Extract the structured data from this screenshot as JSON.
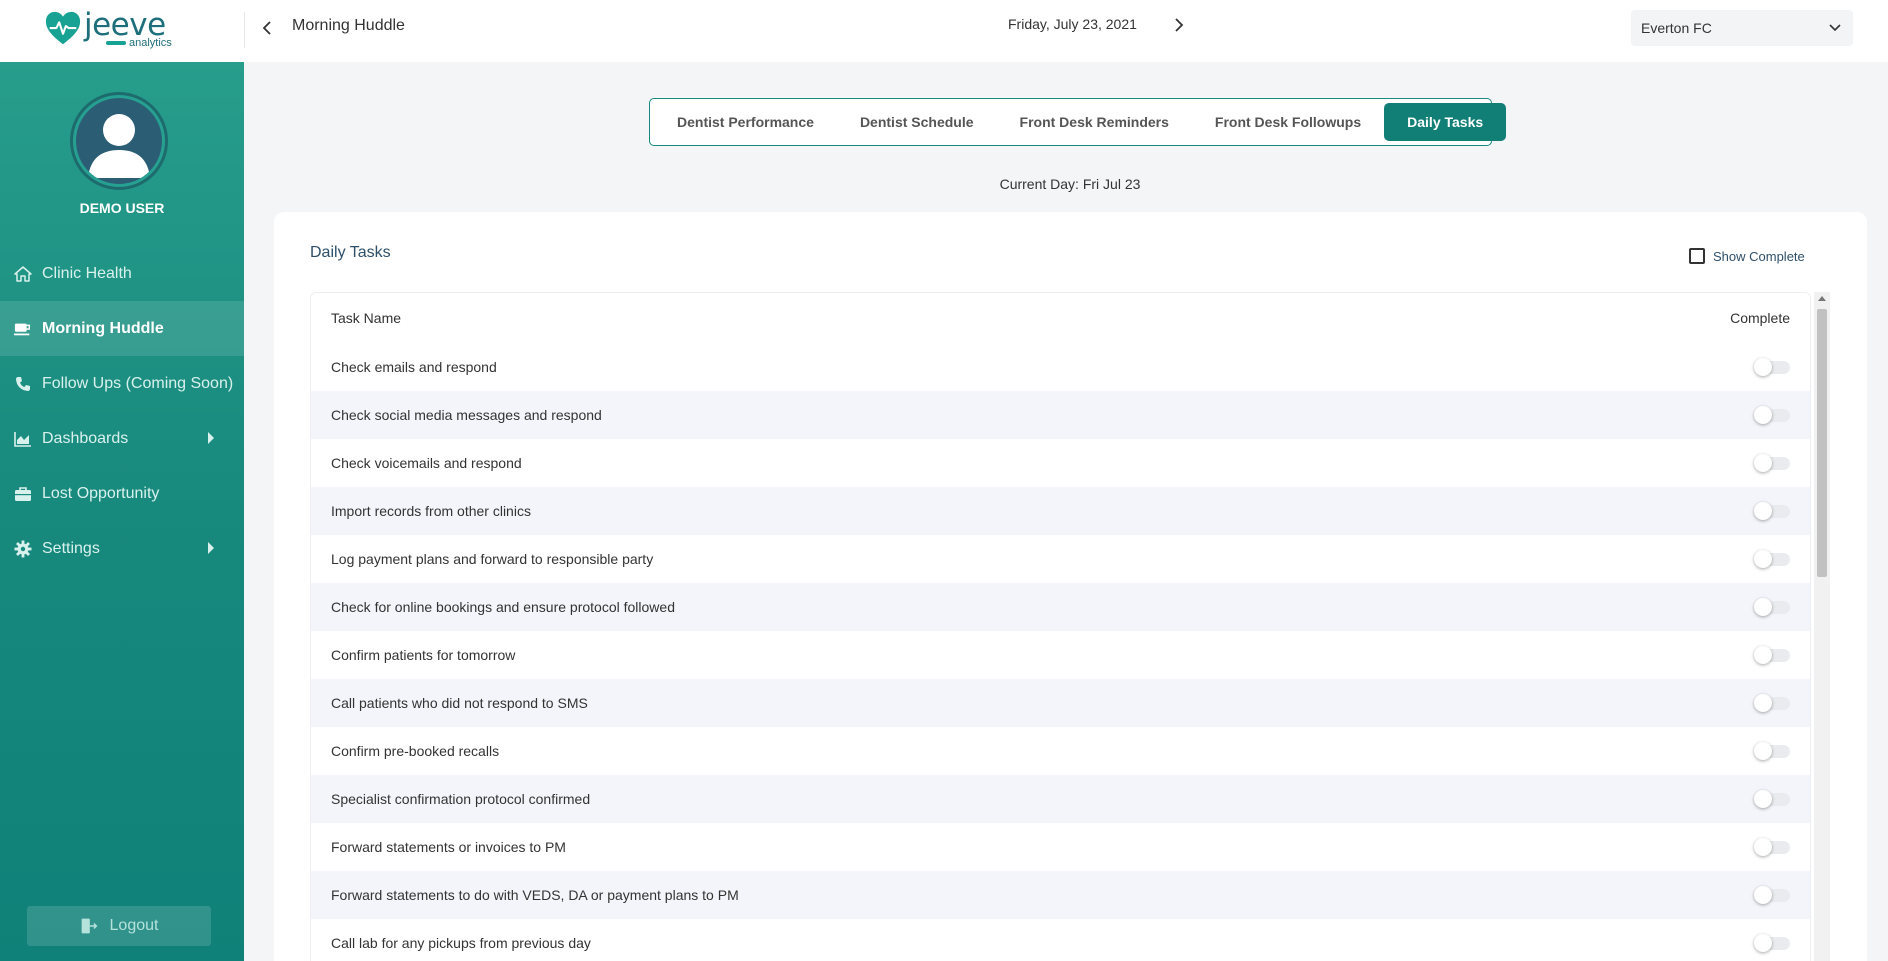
{
  "header": {
    "brand_word": "jeeve",
    "brand_sub": "analytics",
    "title": "Morning Huddle",
    "date": "Friday, July 23, 2021",
    "clinic": "Everton FC"
  },
  "sidebar": {
    "user_name": "DEMO USER",
    "items": [
      {
        "label": "Clinic Health",
        "icon": "home-icon"
      },
      {
        "label": "Morning Huddle",
        "icon": "coffee-cup-icon",
        "active": true
      },
      {
        "label": "Follow Ups (Coming Soon)",
        "icon": "phone-icon"
      },
      {
        "label": "Dashboards",
        "icon": "chart-icon",
        "has_submenu": true
      },
      {
        "label": "Lost Opportunity",
        "icon": "briefcase-icon"
      },
      {
        "label": "Settings",
        "icon": "gear-icon",
        "has_submenu": true
      }
    ],
    "logout_label": "Logout"
  },
  "tabs": [
    {
      "label": "Dentist Performance"
    },
    {
      "label": "Dentist Schedule"
    },
    {
      "label": "Front Desk Reminders"
    },
    {
      "label": "Front Desk Followups"
    },
    {
      "label": "Daily Tasks",
      "active": true
    }
  ],
  "current_day": "Current Day: Fri Jul 23",
  "card": {
    "title": "Daily Tasks",
    "show_complete_label": "Show Complete",
    "show_complete_checked": false
  },
  "table": {
    "columns": [
      "Task Name",
      "Complete"
    ],
    "rows": [
      {
        "task": "Check emails and respond",
        "complete": false
      },
      {
        "task": "Check social media messages and respond",
        "complete": false
      },
      {
        "task": "Check voicemails and respond",
        "complete": false
      },
      {
        "task": "Import records from other clinics",
        "complete": false
      },
      {
        "task": "Log payment plans and forward to responsible party",
        "complete": false
      },
      {
        "task": "Check for online bookings and ensure protocol followed",
        "complete": false
      },
      {
        "task": "Confirm patients for tomorrow",
        "complete": false
      },
      {
        "task": "Call patients who did not respond to SMS",
        "complete": false
      },
      {
        "task": "Confirm pre-booked recalls",
        "complete": false
      },
      {
        "task": "Specialist confirmation protocol confirmed",
        "complete": false
      },
      {
        "task": "Forward statements or invoices to PM",
        "complete": false
      },
      {
        "task": "Forward statements to do with VEDS, DA or payment plans to PM",
        "complete": false
      },
      {
        "task": "Call lab for any pickups from previous day",
        "complete": false
      }
    ]
  },
  "colors": {
    "accent": "#127f76",
    "sidebar_top": "#279d8c",
    "sidebar_bottom": "#0f8178",
    "title_text": "#2f4f69"
  }
}
